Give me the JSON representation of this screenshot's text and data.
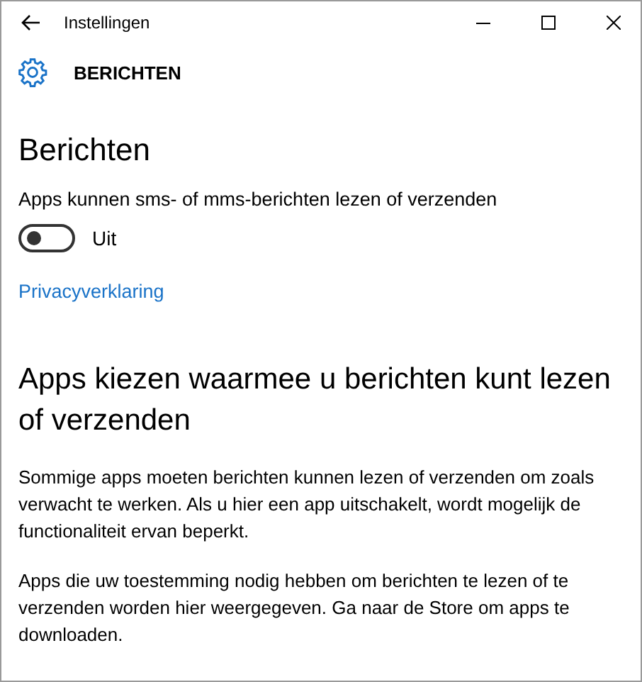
{
  "window": {
    "title": "Instellingen"
  },
  "header": {
    "title": "BERICHTEN"
  },
  "section": {
    "title": "Berichten",
    "setting_label": "Apps kunnen sms- of mms-berichten lezen of verzenden",
    "toggle": {
      "on": false,
      "state_text": "Uit"
    },
    "link": "Privacyverklaring"
  },
  "apps_section": {
    "title": "Apps kiezen waarmee u berichten kunt lezen of verzenden",
    "paragraphs": [
      "Sommige apps moeten berichten kunnen lezen of verzenden om zoals verwacht te werken. Als u hier een app uitschakelt, wordt mogelijk de functionaliteit ervan beperkt.",
      "Apps die uw toestemming nodig hebben om berichten te lezen of te verzenden worden hier weergegeven. Ga naar de Store om apps te downloaden."
    ]
  }
}
